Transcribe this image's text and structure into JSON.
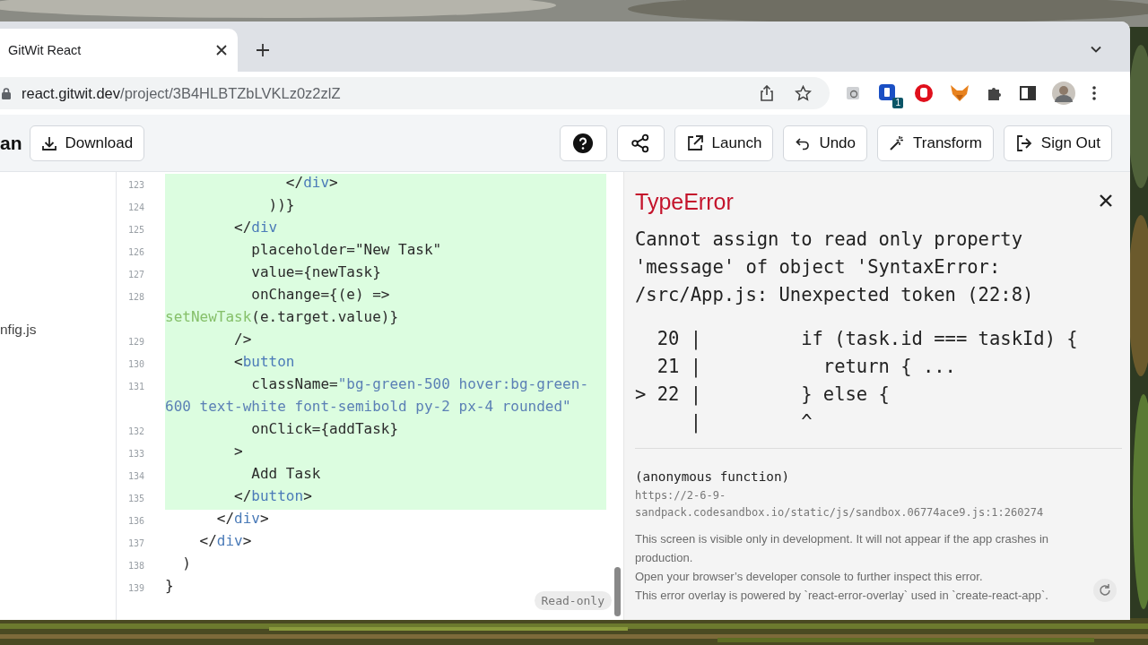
{
  "browser": {
    "tabs": [
      {
        "title": "GitWit React",
        "selected": true
      }
    ],
    "url": {
      "host": "react.gitwit.dev",
      "path": "/project/3B4HLBTZbLVKLz0z2zlZ"
    },
    "extension_badge": "1"
  },
  "toolbar": {
    "project_name": "an",
    "left_buttons": [
      {
        "kind": "download",
        "label": "Download"
      }
    ],
    "right_buttons": [
      {
        "kind": "help"
      },
      {
        "kind": "share"
      },
      {
        "kind": "launch",
        "label": "Launch"
      },
      {
        "kind": "undo",
        "label": "Undo"
      },
      {
        "kind": "transform",
        "label": "Transform"
      },
      {
        "kind": "signout",
        "label": "Sign Out"
      }
    ]
  },
  "sidebar": {
    "files": [
      "nfig.js"
    ]
  },
  "editor": {
    "badge": "Read-only",
    "lines": [
      {
        "number": "123",
        "highlighted": true,
        "tokens": [
          {
            "kind": "plain",
            "text": "              </"
          },
          {
            "kind": "tag",
            "text": "div"
          },
          {
            "kind": "plain",
            "text": ">"
          }
        ]
      },
      {
        "number": "124",
        "highlighted": true,
        "tokens": [
          {
            "kind": "plain",
            "text": "            ))}"
          }
        ]
      },
      {
        "number": "125",
        "highlighted": true,
        "tokens": [
          {
            "kind": "plain",
            "text": "        </"
          },
          {
            "kind": "tag",
            "text": "div"
          }
        ]
      },
      {
        "number": "126",
        "highlighted": true,
        "tokens": [
          {
            "kind": "plain",
            "text": "          placeholder=\"New Task\""
          }
        ]
      },
      {
        "number": "127",
        "highlighted": true,
        "tokens": [
          {
            "kind": "plain",
            "text": "          value={newTask}"
          }
        ]
      },
      {
        "number": "128",
        "highlighted": true,
        "tokens": [
          {
            "kind": "plain",
            "text": "          onChange={(e) =>"
          }
        ]
      },
      {
        "highlighted": true,
        "tokens": [
          {
            "kind": "call",
            "text": "setNewTask"
          },
          {
            "kind": "plain",
            "text": "(e.target.value)}"
          }
        ]
      },
      {
        "number": "129",
        "highlighted": true,
        "tokens": [
          {
            "kind": "plain",
            "text": "        />"
          }
        ]
      },
      {
        "number": "130",
        "highlighted": true,
        "tokens": [
          {
            "kind": "plain",
            "text": "        <"
          },
          {
            "kind": "tag",
            "text": "button"
          }
        ]
      },
      {
        "number": "131",
        "highlighted": true,
        "tokens": [
          {
            "kind": "plain",
            "text": "          className="
          },
          {
            "kind": "string",
            "text": "\"bg-green-500 hover:bg-green-"
          }
        ]
      },
      {
        "highlighted": true,
        "tokens": [
          {
            "kind": "string",
            "text": "600 text-white font-semibold py-2 px-4 rounded\""
          }
        ]
      },
      {
        "number": "132",
        "highlighted": true,
        "tokens": [
          {
            "kind": "plain",
            "text": "          onClick={addTask}"
          }
        ]
      },
      {
        "number": "133",
        "highlighted": true,
        "tokens": [
          {
            "kind": "plain",
            "text": "        >"
          }
        ]
      },
      {
        "number": "134",
        "highlighted": true,
        "tokens": [
          {
            "kind": "plain",
            "text": "          Add Task"
          }
        ]
      },
      {
        "number": "135",
        "highlighted": true,
        "tokens": [
          {
            "kind": "plain",
            "text": "        </"
          },
          {
            "kind": "tag",
            "text": "button"
          },
          {
            "kind": "plain",
            "text": ">"
          }
        ]
      },
      {
        "number": "136",
        "highlighted": false,
        "tokens": [
          {
            "kind": "plain",
            "text": "      </"
          },
          {
            "kind": "tag",
            "text": "div"
          },
          {
            "kind": "plain",
            "text": ">"
          }
        ]
      },
      {
        "number": "137",
        "highlighted": false,
        "tokens": [
          {
            "kind": "plain",
            "text": "    </"
          },
          {
            "kind": "tag",
            "text": "div"
          },
          {
            "kind": "plain",
            "text": ">"
          }
        ]
      },
      {
        "number": "138",
        "highlighted": false,
        "tokens": [
          {
            "kind": "plain",
            "text": "  )"
          }
        ]
      },
      {
        "number": "139",
        "highlighted": false,
        "tokens": [
          {
            "kind": "plain",
            "text": "}"
          }
        ]
      }
    ]
  },
  "error_overlay": {
    "title": "TypeError",
    "message": "Cannot assign to read only property 'message' of object 'SyntaxError: /src/App.js: Unexpected token (22:8)",
    "frame": [
      "  20 |         if (task.id === taskId) {",
      "  21 |           return { ...",
      "> 22 |         } else {",
      "     |         ^"
    ],
    "function": "(anonymous function)",
    "location": "https://2-6-9-sandpack.codesandbox.io/static/js/sandbox.06774ace9.js:1:260274",
    "notes": [
      "This screen is visible only in development. It will not appear if the app crashes in production.",
      "Open your browser’s developer console to further inspect this error.",
      "This error overlay is powered by `react-error-overlay` used in `create-react-app`."
    ]
  }
}
